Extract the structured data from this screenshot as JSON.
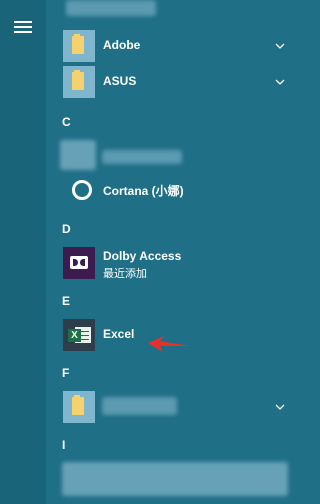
{
  "menu": {
    "icon": "hamburger-menu-icon"
  },
  "sections": {
    "c": "C",
    "d": "D",
    "e": "E",
    "f": "F",
    "i": "I"
  },
  "apps": {
    "adobe": {
      "name": "Adobe",
      "icon": "folder-icon"
    },
    "asus": {
      "name": "ASUS",
      "icon": "folder-icon"
    },
    "cortana": {
      "name": "Cortana (小娜)",
      "icon": "cortana-icon"
    },
    "dolby": {
      "name": "Dolby Access",
      "badge": "最近添加",
      "icon": "dolby-icon"
    },
    "excel": {
      "name": "Excel",
      "icon": "excel-icon"
    }
  },
  "colors": {
    "background": "#1f6f87",
    "sidebar": "#1a6479",
    "folder_tile": "#7fb6cd",
    "folder_yellow": "#f5d26e",
    "annotation_arrow": "#e8302a"
  }
}
